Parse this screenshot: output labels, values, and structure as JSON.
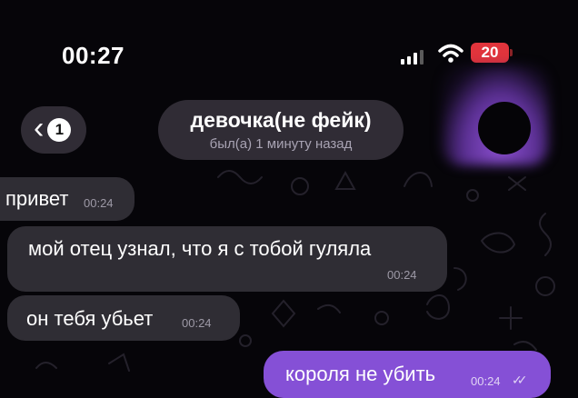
{
  "status_bar": {
    "time": "00:27",
    "battery_level": "20",
    "battery_color": "#e1343c"
  },
  "header": {
    "back_unread_count": "1",
    "chat_name": "девочка(не фейк)",
    "last_seen": "был(а) 1 минуту назад"
  },
  "messages": [
    {
      "direction": "incoming",
      "text": "привет",
      "time": "00:24"
    },
    {
      "direction": "incoming",
      "text": "мой отец узнал, что я с тобой гуляла",
      "time": "00:24"
    },
    {
      "direction": "incoming",
      "text": "он тебя убьет",
      "time": "00:24"
    },
    {
      "direction": "outgoing",
      "text": "короля не убить",
      "time": "00:24",
      "read_status": "read"
    }
  ],
  "colors": {
    "outgoing_bubble": "#8550d6",
    "incoming_bubble": "#322f37",
    "background": "#060509"
  },
  "icons": [
    "cellular-signal-icon",
    "wifi-icon",
    "battery-icon",
    "chevron-left-icon",
    "double-check-icon"
  ]
}
